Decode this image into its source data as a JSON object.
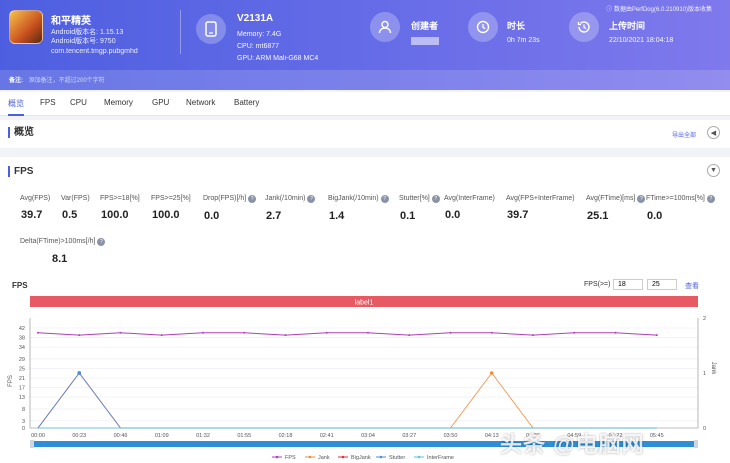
{
  "header": {
    "app_name": "和平精英",
    "android_version": "Android版本名: 1.15.13",
    "android_code": "Android版本号: 9750",
    "package": "com.tencent.tmgp.pubgmhd",
    "device_name": "V2131A",
    "memory": "Memory: 7.4G",
    "cpu": "CPU: mt6877",
    "gpu": "GPU: ARM Mali-G68 MC4",
    "creator_label": "创建者",
    "duration_label": "时长",
    "duration_value": "0h 7m 23s",
    "upload_label": "上传时间",
    "upload_value": "22/10/2021 18:04:18",
    "version_note": "数据由PerfDog(6.0.210910)版本收集",
    "note_label": "备注:",
    "note_placeholder": "添加备注，不超过200个字符"
  },
  "tabs": [
    "概览",
    "FPS",
    "CPU",
    "Memory",
    "GPU",
    "Network",
    "Battery"
  ],
  "overview": {
    "title": "概览",
    "export_label": "导出全部"
  },
  "fps_section": {
    "title": "FPS",
    "metrics": [
      {
        "label": "Avg(FPS)",
        "value": "39.7"
      },
      {
        "label": "Var(FPS)",
        "value": "0.5"
      },
      {
        "label": "FPS>=18[%]",
        "value": "100.0"
      },
      {
        "label": "FPS>=25[%]",
        "value": "100.0"
      },
      {
        "label": "Drop(FPS)[/h]",
        "value": "0.0"
      },
      {
        "label": "Jank(/10min)",
        "value": "2.7"
      },
      {
        "label": "BigJank(/10min)",
        "value": "1.4"
      },
      {
        "label": "Stutter[%]",
        "value": "0.1"
      },
      {
        "label": "Avg(InterFrame)",
        "value": "0.0"
      },
      {
        "label": "Avg(FPS+InterFrame)",
        "value": "39.7"
      },
      {
        "label": "Avg(FTime)[ms]",
        "value": "25.1"
      },
      {
        "label": "FTime>=100ms[%]",
        "value": "0.0"
      },
      {
        "label": "Delta(FTime)>100ms[/h]",
        "value": "8.1"
      }
    ]
  },
  "chart_header": {
    "title": "FPS",
    "threshold_label": "FPS(>=)",
    "threshold_1": "18",
    "threshold_2": "25",
    "query_label": "查看",
    "band_label": "label1"
  },
  "colors": {
    "accent": "#4d5fe0",
    "fps": "#b03fb8",
    "jank": "#f28a3a",
    "bigjank": "#e0303a",
    "stutter": "#4a90d9",
    "interframe": "#59c8d8",
    "band": "#e85a63"
  },
  "watermark": "头条 @电脑网",
  "chart_data": {
    "type": "line",
    "x": [
      "00:00",
      "00:23",
      "00:46",
      "01:09",
      "01:32",
      "01:55",
      "02:18",
      "02:41",
      "03:04",
      "03:27",
      "03:50",
      "04:13",
      "04:36",
      "04:59",
      "05:22",
      "05:45"
    ],
    "ylabel": "FPS",
    "ylim": [
      0,
      42
    ],
    "y_ticks": [
      0,
      3,
      8,
      13,
      17,
      21,
      25,
      29,
      34,
      38,
      42
    ],
    "y2label": "Jank",
    "y2lim": [
      0,
      2
    ],
    "y2_ticks": [
      0,
      1,
      2
    ],
    "series": [
      {
        "name": "FPS",
        "values": [
          40,
          39,
          40,
          39,
          40,
          40,
          39,
          40,
          40,
          39,
          40,
          40,
          39,
          40,
          40,
          39
        ]
      },
      {
        "name": "Jank",
        "values": [
          0,
          1,
          0,
          0,
          0,
          0,
          0,
          0,
          0,
          0,
          0,
          1,
          0,
          0,
          0,
          0
        ]
      },
      {
        "name": "BigJank",
        "values": [
          0,
          1,
          0,
          0,
          0,
          0,
          0,
          0,
          0,
          0,
          0,
          0,
          0,
          0,
          0,
          0
        ]
      },
      {
        "name": "Stutter",
        "values": [
          0,
          1,
          0,
          0,
          0,
          0,
          0,
          0,
          0,
          0,
          0,
          0,
          0,
          0,
          0,
          0
        ]
      },
      {
        "name": "InterFrame",
        "values": [
          0,
          0,
          0,
          0,
          0,
          0,
          0,
          0,
          0,
          0,
          0,
          0,
          0,
          0,
          0,
          0
        ]
      }
    ],
    "legend_position": "bottom"
  }
}
